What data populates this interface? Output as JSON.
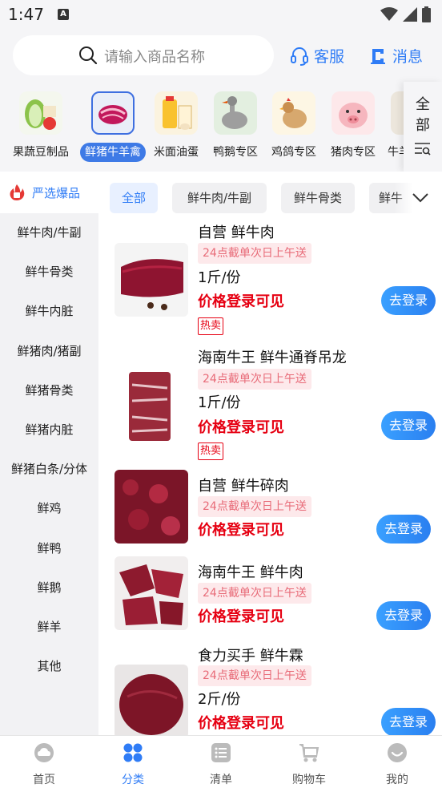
{
  "status": {
    "time": "1:47",
    "a_badge": "A"
  },
  "header": {
    "search_placeholder": "请输入商品名称",
    "service_label": "客服",
    "message_label": "消息"
  },
  "categories": [
    {
      "label": "果蔬豆制品"
    },
    {
      "label": "鲜猪牛羊禽"
    },
    {
      "label": "米面油蛋"
    },
    {
      "label": "鸭鹅专区"
    },
    {
      "label": "鸡鸽专区"
    },
    {
      "label": "猪肉专区"
    },
    {
      "label": "牛羊"
    }
  ],
  "all_categories": {
    "line1": "全",
    "line2": "部"
  },
  "sidebar": {
    "top_label": "严选爆品",
    "items": [
      "鲜牛肉/牛副",
      "鲜牛骨类",
      "鲜牛内脏",
      "鲜猪肉/猪副",
      "鲜猪骨类",
      "鲜猪内脏",
      "鲜猪白条/分体",
      "鲜鸡",
      "鲜鸭",
      "鲜鹅",
      "鲜羊",
      "其他"
    ]
  },
  "tabs": [
    "全部",
    "鲜牛肉/牛副",
    "鲜牛骨类",
    "鲜牛"
  ],
  "products": [
    {
      "title": "自营 鲜牛肉",
      "tag": "24点截单次日上午送",
      "unit": "1斤/份",
      "price": "价格登录可见",
      "hot": "热卖",
      "button": "去登录"
    },
    {
      "title": "海南牛王 鲜牛通脊吊龙",
      "tag": "24点截单次日上午送",
      "unit": "1斤/份",
      "price": "价格登录可见",
      "hot": "热卖",
      "button": "去登录"
    },
    {
      "title": "自营 鲜牛碎肉",
      "tag": "24点截单次日上午送",
      "price": "价格登录可见",
      "button": "去登录"
    },
    {
      "title": "海南牛王 鲜牛肉",
      "tag": "24点截单次日上午送",
      "price": "价格登录可见",
      "button": "去登录"
    },
    {
      "title": "食力买手 鲜牛霖",
      "tag": "24点截单次日上午送",
      "unit": "2斤/份",
      "price": "价格登录可见",
      "button": "去登录"
    }
  ],
  "bottom_nav": [
    "首页",
    "分类",
    "清单",
    "购物车",
    "我的"
  ],
  "colors": {
    "accent": "#2f7cf6",
    "price": "#e60012",
    "tag_bg": "#fde9eb",
    "tag_text": "#e86b78"
  }
}
